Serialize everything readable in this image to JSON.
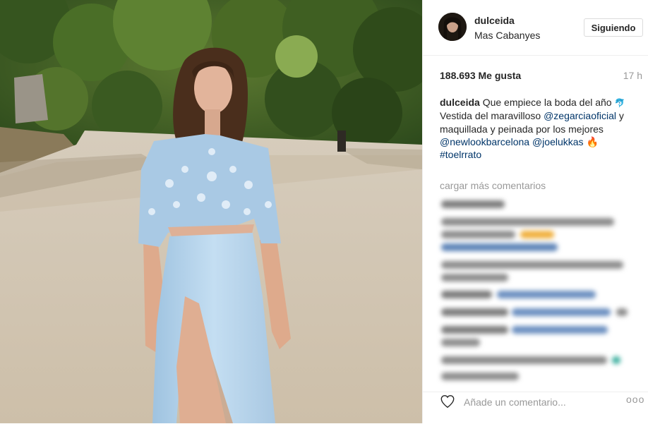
{
  "post": {
    "username": "dulceida",
    "location": "Mas Cabanyes",
    "follow_label": "Siguiendo",
    "likes": "188.693 Me gusta",
    "time_ago": "17 h"
  },
  "caption": {
    "username": "dulceida",
    "line1": "Que empiece la boda del año",
    "line2": "Vestida del maravilloso",
    "tag1": "@zegarciaoficial",
    "line3": "y maquillada y peinada por los mejores",
    "tag2": "@newlookbarcelona",
    "tag3": "@joelukkas",
    "emoji_dolphin": "🐬",
    "emoji_fire": "🔥",
    "hashtag": "#toelrrato"
  },
  "comments": {
    "load_more": "cargar más comentarios"
  },
  "footer": {
    "comment_placeholder": "Añade un comentario...",
    "more_label": "ooo"
  },
  "colors": {
    "link": "#003569",
    "muted": "#999999",
    "border": "#efefef"
  },
  "icons": [
    "heart-icon",
    "dolphin-emoji",
    "fire-emoji",
    "more-options-icon"
  ]
}
